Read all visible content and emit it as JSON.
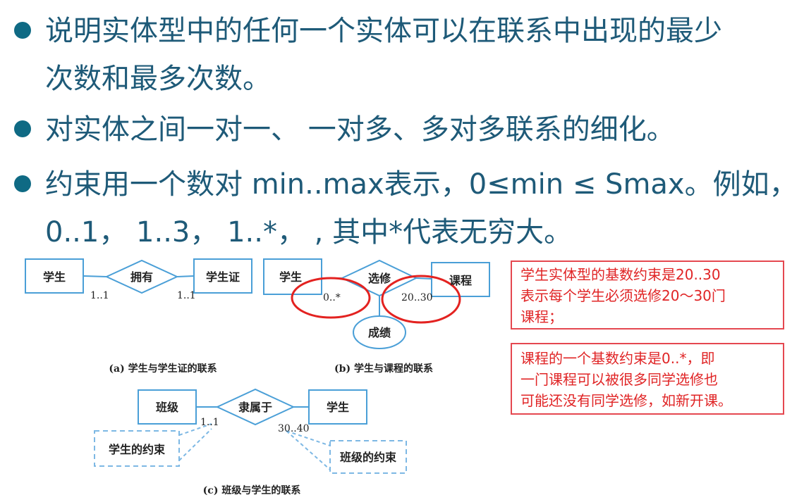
{
  "bullets": [
    {
      "lines": [
        "说明实体型中的任何一个实体可以在联系中出现的最少",
        "次数和最多次数。"
      ]
    },
    {
      "lines": [
        "对实体之间一对一、 一对多、多对多联系的细化。"
      ]
    },
    {
      "lines": [
        "约束用一个数对 min..max表示，0≤min ≤ Smax。例如，",
        "0..1， 1..3， 1..*， , 其中*代表无穷大。"
      ]
    }
  ],
  "diagram": {
    "panel_a": {
      "entity_left": "学生",
      "relation": "拥有",
      "entity_right": "学生证",
      "card_left": "1..1",
      "card_right": "1..1",
      "caption": "(a) 学生与学生证的联系"
    },
    "panel_b": {
      "entity_left": "学生",
      "relation": "选修",
      "entity_right": "课程",
      "attribute": "成绩",
      "card_left": "0..*",
      "card_right": "20..30",
      "caption": "(b) 学生与课程的联系"
    },
    "panel_c": {
      "entity_left": "班级",
      "relation": "隶属于",
      "entity_right": "学生",
      "card_left": "1..1",
      "card_right": "30..40",
      "constraint_left": "学生的约束",
      "constraint_right": "班级的约束",
      "caption": "(c) 班级与学生的联系"
    }
  },
  "notes": [
    {
      "lines": [
        "学生实体型的基数约束是20..30",
        "表示每个学生必须选修20～30门",
        "课程；"
      ]
    },
    {
      "lines": [
        "课程的一个基数约束是0..*，即",
        "一门课程可以被很多同学选修也",
        "可能还没有同学选修，如新开课。"
      ]
    }
  ],
  "colors": {
    "text": "#1e5a78",
    "bullet": "#0f6a84",
    "diagram_line": "#4a9fd7",
    "highlight": "#e32220",
    "note_border": "#e54850",
    "note_text": "#e02425"
  }
}
